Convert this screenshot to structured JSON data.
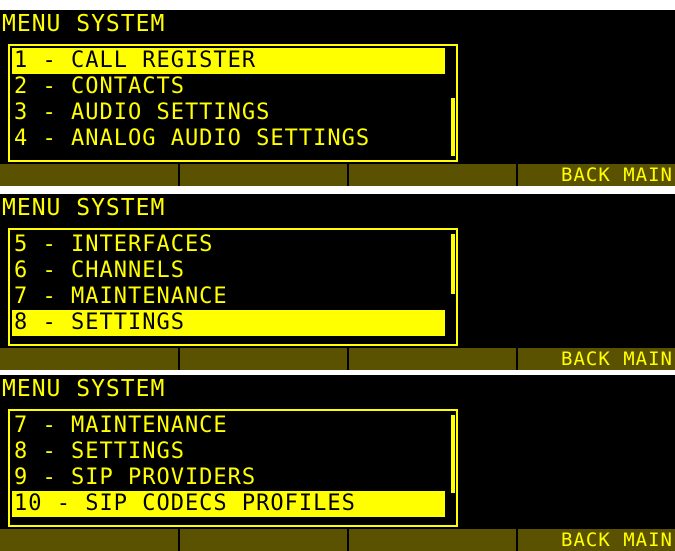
{
  "screens": [
    {
      "title": "MENU SYSTEM",
      "items": [
        "1 - CALL REGISTER",
        "2 - CONTACTS",
        "3 - AUDIO SETTINGS",
        "4 - ANALOG AUDIO SETTINGS"
      ],
      "selected_index": 0,
      "softkeys": [
        "",
        "",
        "",
        "BACK MAIN"
      ]
    },
    {
      "title": "MENU SYSTEM",
      "items": [
        "5 - INTERFACES",
        "6 - CHANNELS",
        "7 - MAINTENANCE",
        "8 - SETTINGS"
      ],
      "selected_index": 3,
      "softkeys": [
        "",
        "",
        "",
        "BACK MAIN"
      ]
    },
    {
      "title": "MENU SYSTEM",
      "items": [
        "7 - MAINTENANCE",
        "8 - SETTINGS",
        "9 - SIP PROVIDERS",
        "10 - SIP CODECS PROFILES"
      ],
      "selected_index": 3,
      "softkeys": [
        "",
        "",
        "",
        "BACK MAIN"
      ]
    }
  ],
  "colors": {
    "foreground": "#ffff00",
    "background": "#000000",
    "softkey_bg": "#5a5200"
  }
}
